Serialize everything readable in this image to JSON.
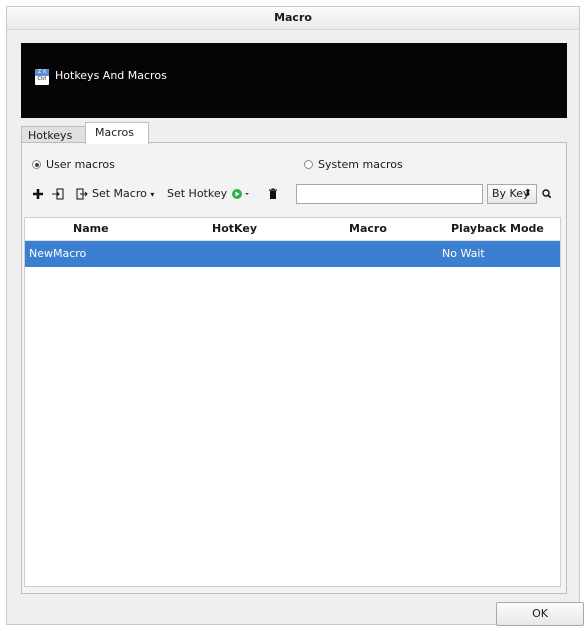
{
  "window": {
    "title": "Macro"
  },
  "banner": {
    "title": "Hotkeys And Macros",
    "icon_top": "Z X",
    "icon_bottom": "Ctrl"
  },
  "tabs": [
    {
      "label": "Hotkeys",
      "active": false
    },
    {
      "label": "Macros",
      "active": true
    }
  ],
  "radios": {
    "user": {
      "label": "User macros",
      "checked": true
    },
    "system": {
      "label": "System macros",
      "checked": false
    }
  },
  "toolbar": {
    "add_icon": "+",
    "import_icon": "import-icon",
    "export_icon": "export-icon",
    "set_macro_label": "Set Macro",
    "set_hotkey_label": "Set Hotkey",
    "play_icon": "play-icon",
    "delete_icon": "trash-icon",
    "search_value": "",
    "search_placeholder": "",
    "sort_value": "By Key",
    "search_icon": "magnifier-icon"
  },
  "table": {
    "columns": [
      "Name",
      "HotKey",
      "Macro",
      "Playback Mode"
    ],
    "rows": [
      {
        "name": "NewMacro",
        "hotkey": "",
        "macro": "",
        "playback": "No Wait",
        "selected": true
      }
    ]
  },
  "footer": {
    "ok_label": "OK"
  },
  "colors": {
    "selection": "#3b7fd0",
    "banner_bg": "#050505",
    "play_green": "#2bb24c"
  }
}
